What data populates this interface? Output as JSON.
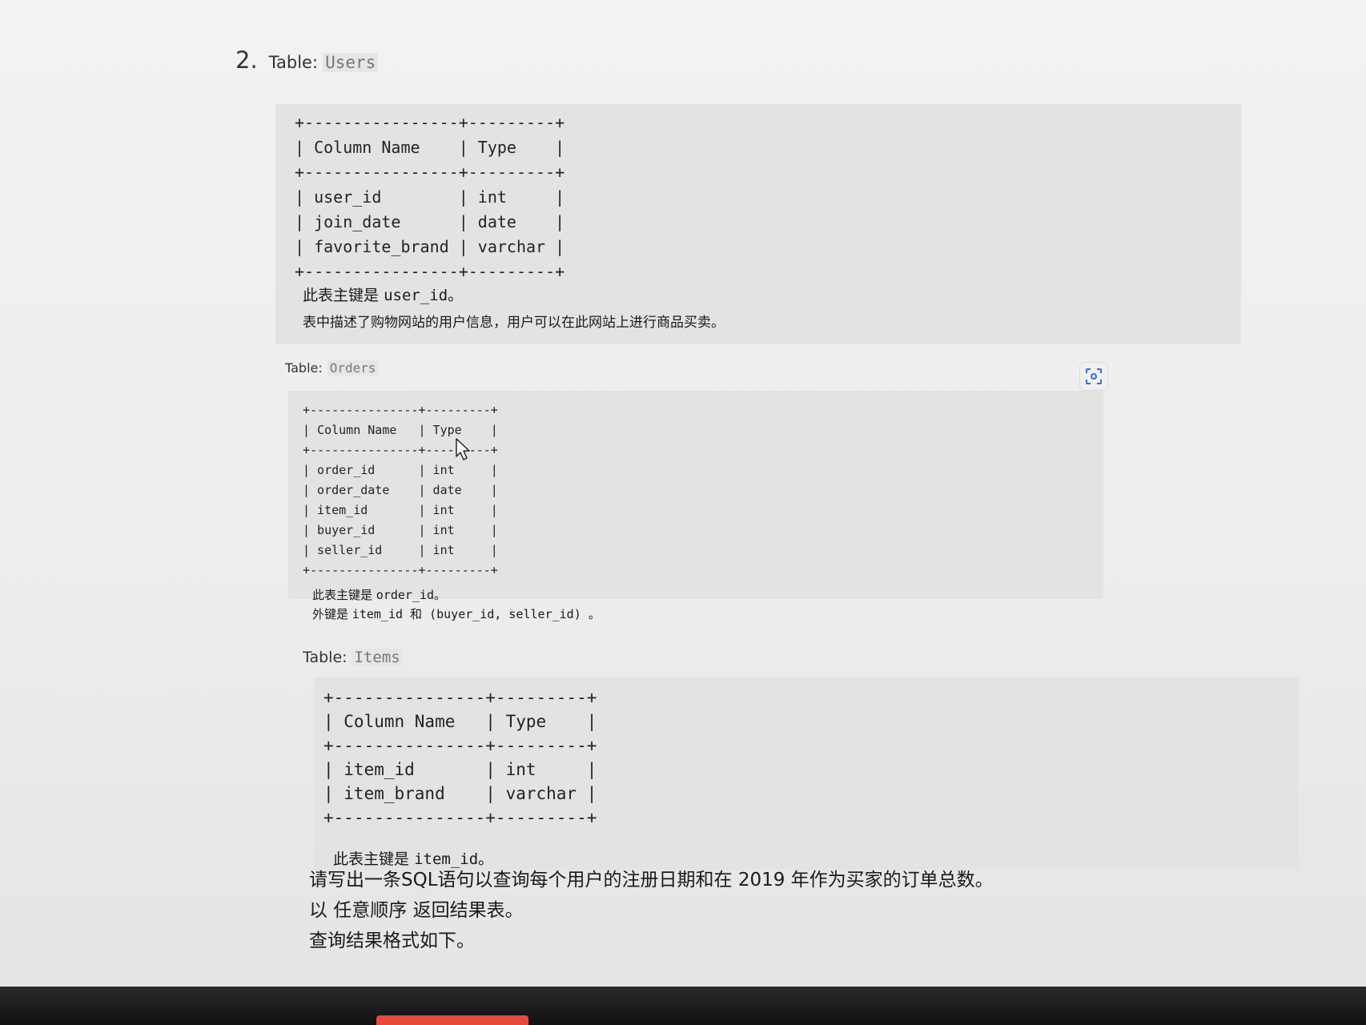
{
  "problem": {
    "number": "2.",
    "users": {
      "label": "Table:",
      "name": "Users",
      "schema": "+----------------+---------+\n| Column Name    | Type    |\n+----------------+---------+\n| user_id        | int     |\n| join_date      | date    |\n| favorite_brand | varchar |\n+----------------+---------+",
      "note_pk_prefix": "此表主键是",
      "note_pk_value": "user_id。",
      "note_desc": "表中描述了购物网站的用户信息，用户可以在此网站上进行商品买卖。"
    },
    "orders": {
      "label": "Table:",
      "name": "Orders",
      "schema": "+---------------+---------+\n| Column Name   | Type    |\n+---------------+---------+\n| order_id      | int     |\n| order_date    | date    |\n| item_id       | int     |\n| buyer_id      | int     |\n| seller_id     | int     |\n+---------------+---------+",
      "note_pk_prefix": "此表主键是",
      "note_pk_value": "order_id。",
      "note_fk_prefix": "外键是",
      "note_fk_value": "item_id 和 (buyer_id, seller_id) 。"
    },
    "items": {
      "label": "Table:",
      "name": "Items",
      "schema": "+---------------+---------+\n| Column Name   | Type    |\n+---------------+---------+\n| item_id       | int     |\n| item_brand    | varchar |\n+---------------+---------+",
      "note_pk_prefix": "此表主键是",
      "note_pk_value": "item_id。"
    },
    "question_lines": [
      "请写出一条SQL语句以查询每个用户的注册日期和在 2019 年作为买家的订单总数。",
      "以 任意顺序 返回结果表。",
      "查询结果格式如下。"
    ]
  },
  "icons": {
    "scan": "scan-icon",
    "cursor": "mouse-cursor-icon"
  }
}
